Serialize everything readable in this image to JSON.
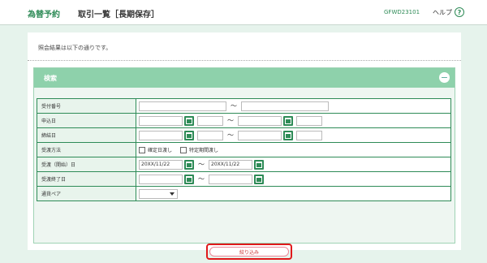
{
  "header": {
    "brand": "為替予約",
    "title": "取引一覧［長期保存］",
    "screen_id": "GFWD23101",
    "help_label": "ヘルプ",
    "help_icon": "?"
  },
  "main": {
    "result_message": "照会結果は以下の通りです。",
    "search": {
      "title": "検索",
      "collapse_icon": "−",
      "tilde": "〜",
      "rows": {
        "receipt_no": "受付番号",
        "apply_date": "申込日",
        "contract_date": "締結日",
        "delivery_method": "受渡方法",
        "delivery_start": "受渡（開始）日",
        "delivery_end": "受渡終了日",
        "currency_pair": "通貨ペア"
      },
      "checkbox_fixed": "確定日渡し",
      "checkbox_period": "特定期間渡し",
      "delivery_start_from": "20XX/11/22",
      "delivery_start_to": "20XX/11/22",
      "filter_button": "絞り込み"
    }
  }
}
